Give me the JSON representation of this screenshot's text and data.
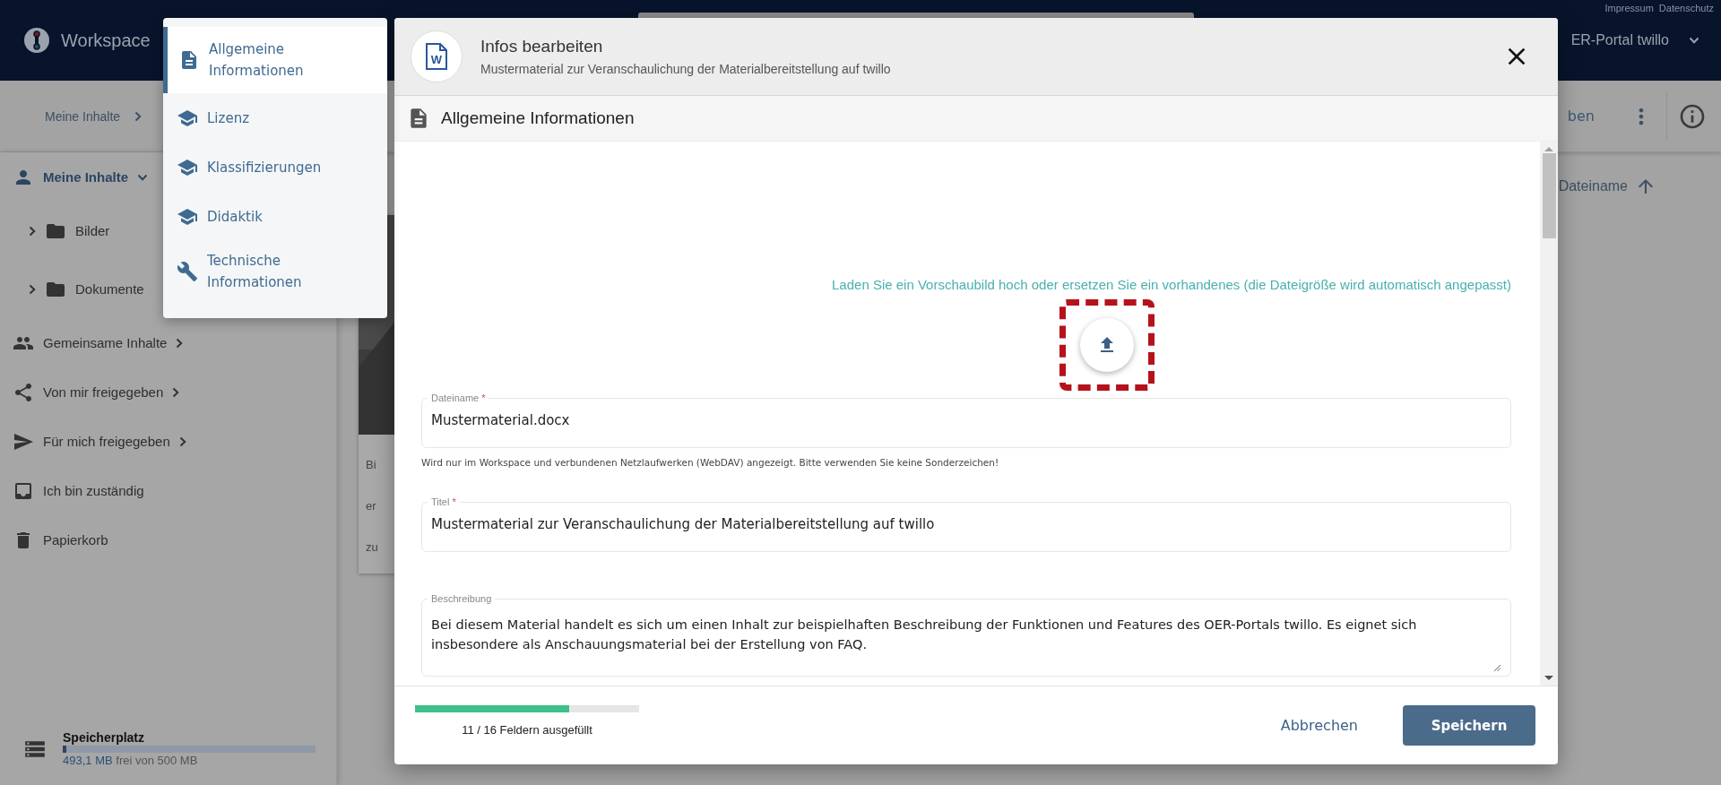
{
  "header": {
    "links": [
      "Impressum",
      "Datenschutz"
    ],
    "app_name": "Workspace",
    "portal": "ER-Portal twillo"
  },
  "toolbar": {
    "breadcrumb": [
      "Meine Inhalte"
    ],
    "action_partial": "ben"
  },
  "sidebar": {
    "items": [
      {
        "label": "Meine Inhalte",
        "kind": "user",
        "expanded": true,
        "children": [
          {
            "label": "Bilder",
            "kind": "folder",
            "expanded": false
          },
          {
            "label": "Dokumente",
            "kind": "folder",
            "expanded": false
          }
        ]
      },
      {
        "label": "Gemeinsame Inhalte",
        "kind": "group",
        "submenu": true
      },
      {
        "label": "Von mir freigegeben",
        "kind": "share",
        "submenu": true
      },
      {
        "label": "Für mich freigegeben",
        "kind": "send",
        "submenu": true
      },
      {
        "label": "Ich bin zuständig",
        "kind": "inbox",
        "submenu": false
      },
      {
        "label": "Papierkorb",
        "kind": "trash",
        "submenu": false
      }
    ]
  },
  "storage": {
    "title": "Speicherplatz",
    "used": "493,1 MB",
    "rest": "frei von 500 MB",
    "level": 0.014
  },
  "content": {
    "sort_label": "Dateiname",
    "card_lines": [
      "Bi",
      "er",
      "zu"
    ]
  },
  "section_menu": {
    "items": [
      {
        "label": "Allgemeine Informationen",
        "kind": "document",
        "selected": true
      },
      {
        "label": "Lizenz",
        "kind": "cap",
        "selected": false
      },
      {
        "label": "Klassifizierungen",
        "kind": "cap",
        "selected": false
      },
      {
        "label": "Didaktik",
        "kind": "cap",
        "selected": false
      },
      {
        "label": "Technische Informationen",
        "kind": "wrench",
        "selected": false
      }
    ]
  },
  "dialog": {
    "file_letter": "W",
    "title": "Infos bearbeiten",
    "subtitle": "Mustermaterial zur Veranschaulichung der Materialbereitstellung auf twillo",
    "section": "Allgemeine Informationen",
    "upload_hint": "Laden Sie ein Vorschaubild hoch oder ersetzen Sie ein vorhandenes (die Dateigröße wird automatisch angepasst)",
    "upload_highlighted": true,
    "fields": [
      {
        "label": "Dateiname",
        "required": true,
        "kind": "input",
        "value": "Mustermaterial.docx",
        "hint": "Wird nur im Workspace und verbundenen Netzlaufwerken (WebDAV) angezeigt. Bitte verwenden Sie keine Sonderzeichen!"
      },
      {
        "label": "Titel",
        "required": true,
        "kind": "input",
        "value": "Mustermaterial zur Veranschaulichung der Materialbereitstellung auf twillo"
      },
      {
        "label": "Beschreibung",
        "required": false,
        "kind": "textarea",
        "value": "Bei diesem Material handelt es sich um einen Inhalt zur beispielhaften Beschreibung der Funktionen und Features des OER-Portals twillo. Es eignet sich insbesondere als Anschauungsmaterial bei der Erstellung von FAQ."
      }
    ],
    "required_mark": "*",
    "progress": {
      "level": 0.6875,
      "text": "11 / 16 Feldern ausgefüllt"
    },
    "buttons": [
      {
        "label": "Abbrechen",
        "kind": "text"
      },
      {
        "label": "Speichern",
        "kind": "primary"
      }
    ]
  }
}
